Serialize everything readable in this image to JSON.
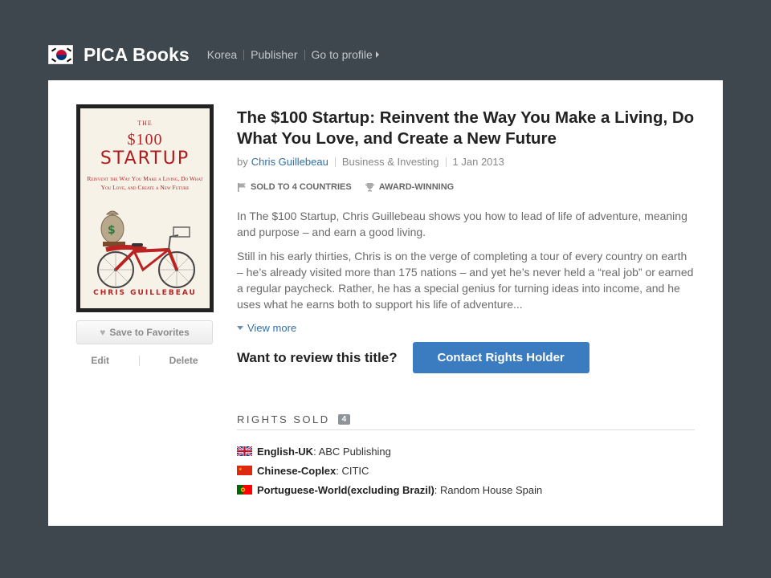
{
  "header": {
    "brand": "PICA Books",
    "breadcrumbs": [
      "Korea",
      "Publisher",
      "Go to profile"
    ]
  },
  "book": {
    "cover": {
      "the": "THE",
      "amount": "$100",
      "title": "STARTUP",
      "subtitle": "Reinvent the Way You Make a Living, Do What You Love, and Create a New Future",
      "author": "CHRIS GUILLEBEAU"
    },
    "title": "The $100 Startup: Reinvent the Way You Make a Living, Do What You Love, and Create a New Future",
    "by": "by",
    "author": "Chris Guillebeau",
    "category": "Business & Investing",
    "date": "1 Jan 2013",
    "badges": {
      "sold": "SOLD TO 4 COUNTRIES",
      "award": "AWARD-WINNING"
    },
    "description": [
      "In The $100 Startup, Chris Guillebeau shows you how to lead of life of adventure, meaning and purpose – and earn a good living.",
      "Still in his early thirties, Chris is on the verge of completing a tour of every country on earth – he’s already visited more than 175 nations – and yet he’s never held a “real job” or earned a regular paycheck.  Rather, he has a special genius for turning ideas into income, and he uses what he earns both to support his life of adventure..."
    ],
    "view_more": "View more"
  },
  "actions": {
    "favorite": "Save to Favorites",
    "edit": "Edit",
    "delete": "Delete",
    "review_question": "Want to review this title?",
    "contact": "Contact Rights Holder"
  },
  "rights": {
    "heading": "RIGHTS SOLD",
    "count": "4",
    "items": [
      {
        "lang": "English-UK",
        "publisher": ": ABC Publishing",
        "flag": "uk"
      },
      {
        "lang": "Chinese-Coplex",
        "publisher": ": CITIC",
        "flag": "cn"
      },
      {
        "lang": "Portuguese-World(excluding Brazil)",
        "publisher": ": Random House Spain",
        "flag": "pt"
      }
    ]
  },
  "colors": {
    "background": "#3e474d",
    "accent": "#3a7cbf",
    "link": "#2e6fa7"
  }
}
